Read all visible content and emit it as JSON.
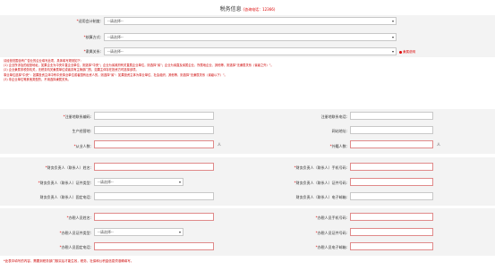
{
  "header": {
    "title": "税务信息",
    "note": "(咨询电话：12366)"
  },
  "tax_section": {
    "accounting_system": {
      "label": "适用会计制度:",
      "value": "--请选择--"
    },
    "calc_method": {
      "label": "核算方式:",
      "value": "--请选择--"
    },
    "affiliation": {
      "label": "隶属关系:",
      "value": "--请选择--",
      "hint": "隶属说明"
    }
  },
  "info_lines": [
    "请经营范围含有广告业的企业填写此项，具体填写规则如下：",
    "(1) 企业所涉及的经营地址，如果企业为中央中直企业单位，则选择\"中央\"；企业为省政府有关直属企业单位，则选择\"省\"；企业为省直及省属企业、所属地企业、其他等，则选择\"无隶属关系（省级之外）\"。",
    "(2) 企业隶属非税务机关，无税务机关隶属单位或者具有主管部门的，如果主体存在投资方时选择该项。",
    "事业单位选择\"中央\"：如果投资主体中有中央事业单位或者国有出资人的，则选择\"省\"：如果投资主体为事业单位、社会组织、其他等，则选择\"无隶属关系（省级以下）\"。",
    "(3) 非企业单位等其他类型的，不用选择隶属关系。"
  ],
  "business_section": {
    "registration_number": {
      "label": "注册地联系编码:"
    },
    "registration_phone": {
      "label": "注册地联系电话:"
    },
    "business_address": {
      "label": "生产经营地:"
    },
    "website": {
      "label": "网站地址:"
    },
    "employees": {
      "label": "从业人数:",
      "unit": "人"
    },
    "foreign_employees": {
      "label": "外籍人数:",
      "unit": "人"
    }
  },
  "finance_section": {
    "name": {
      "label": "财务负责人（联系人）姓名:"
    },
    "mobile": {
      "label": "财务负责人（联系人）手机号码:"
    },
    "id_type": {
      "label": "财务负责人（联系人）证件类型:",
      "value": "--请选择--"
    },
    "id_number": {
      "label": "财务负责人（联系人）证件号码:"
    },
    "landline": {
      "label": "财务负责人（联系人）固定电话:"
    },
    "email": {
      "label": "财务负责人（联系人）电子邮箱:"
    }
  },
  "tax_agent_section": {
    "name": {
      "label": "办税人员姓名:"
    },
    "mobile": {
      "label": "办税人员手机号码:"
    },
    "id_type": {
      "label": "办税人员证件类型:",
      "value": "--请选择--"
    },
    "id_number": {
      "label": "办税人员证件号码:"
    },
    "landline": {
      "label": "办税人员固定电话:"
    },
    "email": {
      "label": "办税人员电子邮箱:"
    }
  },
  "footer": {
    "note": "*此表中填写的内容，需要到税务部门核实后才能生效，税务、社保和公积金信息须准确填写。"
  }
}
